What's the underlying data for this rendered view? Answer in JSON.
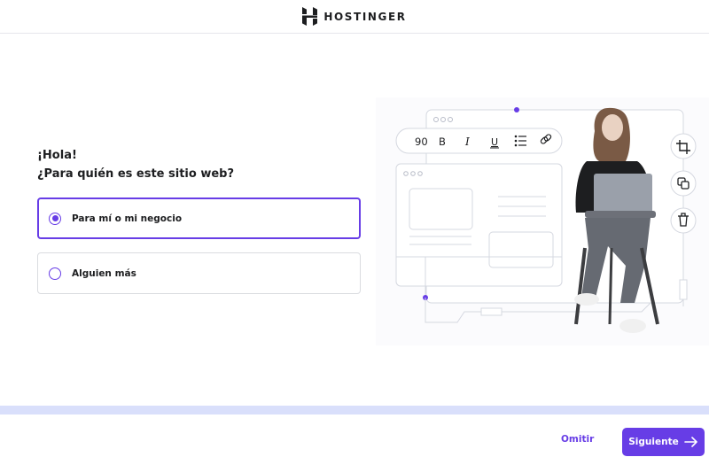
{
  "header": {
    "brand": "HOSTINGER",
    "logo_icon": "hostinger-logo-icon"
  },
  "main": {
    "greeting": "¡Hola!",
    "question": "¿Para quién es este sitio web?",
    "options": [
      {
        "label": "Para mí o mi negocio",
        "selected": true
      },
      {
        "label": "Alguien más",
        "selected": false
      }
    ]
  },
  "illustration": {
    "toolbar": {
      "font_size": "90",
      "bold": "B",
      "italic": "I",
      "underline": "U"
    },
    "icons": [
      "list-icon",
      "link-icon",
      "crop-icon",
      "copy-icon",
      "trash-icon"
    ]
  },
  "footer": {
    "skip_label": "Omitir",
    "next_label": "Siguiente",
    "accent": "#673de6",
    "progress_track_color": "#d9dffb"
  }
}
